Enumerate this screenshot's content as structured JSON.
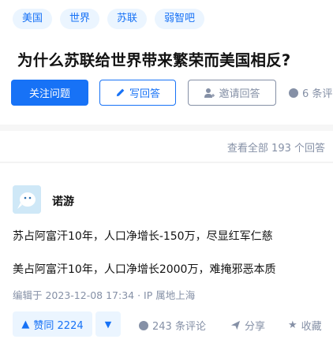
{
  "question": {
    "tags": [
      "美国",
      "世界",
      "苏联",
      "弱智吧"
    ],
    "title": "为什么苏联给世界带来繁荣而美国相反?",
    "follow_label": "关注问题",
    "write_label": "写回答",
    "invite_label": "邀请回答",
    "comment_count": "6 条评"
  },
  "view_all": "查看全部 193 个回答",
  "answer": {
    "author": "诺游",
    "paragraphs": [
      "苏占阿富汗10年，人口净增长-150万，尽显红军仁慈",
      "美占阿富汗10年，人口净增长2000万，难掩邪恶本质"
    ],
    "meta": "编辑于 2023-12-08 17:34 · IP 属地上海",
    "upvote_label": "赞同 2224",
    "comments": "243 条评论",
    "share": "分享",
    "favorite": "收藏"
  },
  "colors": {
    "accent": "#1772f6",
    "muted": "#8590a6",
    "tag_bg": "#ebf5ff"
  }
}
